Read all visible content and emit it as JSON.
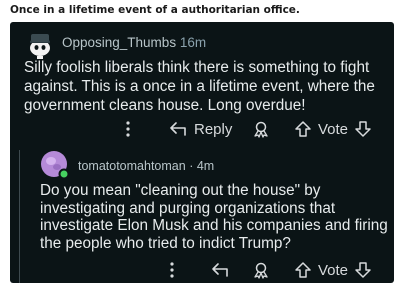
{
  "caption": "Once in a lifetime event of a authoritarian office.",
  "comment": {
    "username": "Opposing_Thumbs",
    "time": "16m",
    "body": "Silly foolish liberals think there is something to fight against. This is a once in a lifetime event, where the government cleans house.  Long overdue!",
    "reply_label": "Reply",
    "vote_label": "Vote"
  },
  "reply": {
    "username": "tomatotomahtoman",
    "separator": "·",
    "time": "4m",
    "body": "Do you mean \"cleaning out the house\" by investigating and purging organizations that investigate Elon Musk and his companies and firing the people who tried to indict Trump?",
    "vote_label": "Vote"
  },
  "colors": {
    "background": "#0b1416",
    "text": "#e8eced",
    "muted": "#b8c5c9",
    "online": "#46d160",
    "avatar2": "#b58ad8"
  },
  "icons": [
    "snoo-avatar-icon",
    "more-options-icon",
    "reply-arrow-icon",
    "award-icon",
    "upvote-icon",
    "downvote-icon",
    "avatar-icon",
    "online-status-icon"
  ]
}
